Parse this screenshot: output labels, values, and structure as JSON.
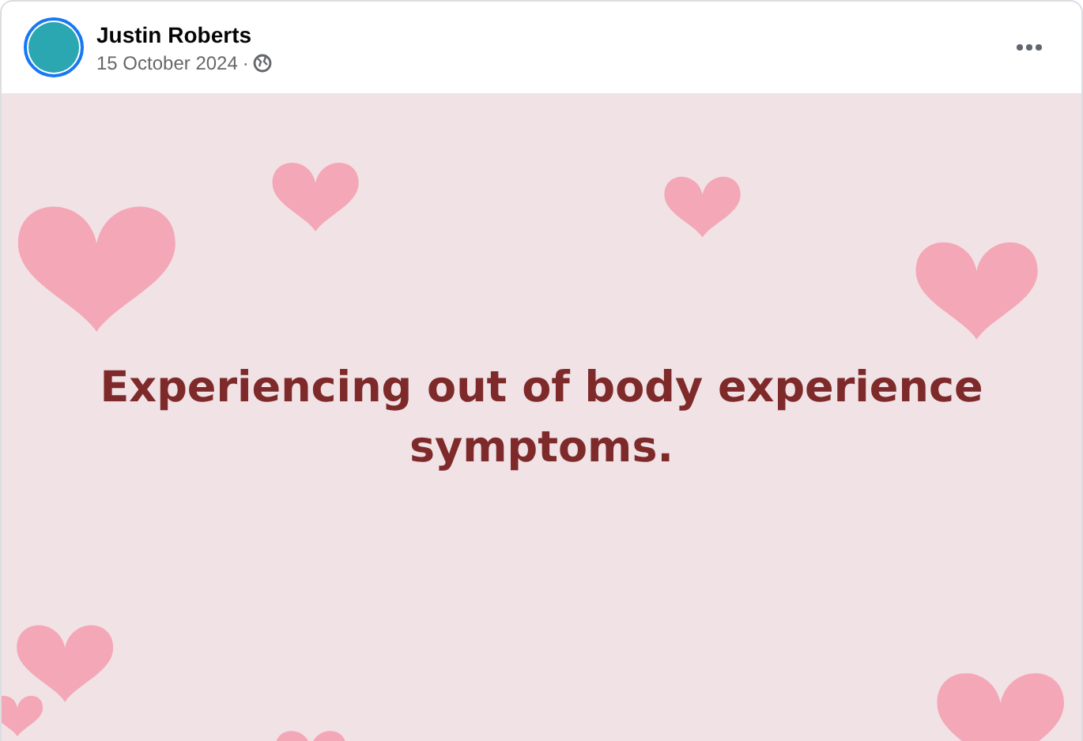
{
  "post": {
    "author": "Justin Roberts",
    "date": "15 October 2024",
    "separator": "·",
    "story_ring": true,
    "text": "Experiencing out of body experience symptoms."
  }
}
